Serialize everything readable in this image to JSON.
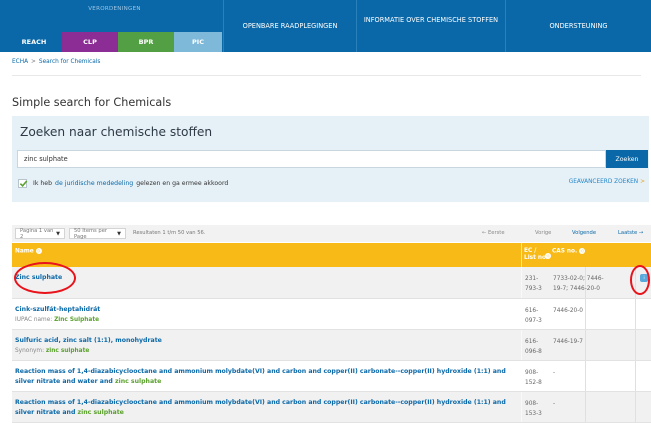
{
  "nav": {
    "regulations_label": "VERORDENINGEN",
    "tabs": [
      {
        "label": "REACH",
        "color": "#0a68a8"
      },
      {
        "label": "CLP",
        "color": "#8c2c95"
      },
      {
        "label": "BPR",
        "color": "#52a043"
      },
      {
        "label": "PIC",
        "color": "#7fb9d9"
      }
    ],
    "items": [
      {
        "label": "OPENBARE RAADPLEGINGEN"
      },
      {
        "label": "INFORMATIE OVER CHEMISCHE STOFFEN"
      },
      {
        "label": "ONDERSTEUNING"
      }
    ]
  },
  "breadcrumb": {
    "home": "ECHA",
    "separator": ">",
    "current": "Search for Chemicals"
  },
  "page_title": "Simple search for Chemicals",
  "search": {
    "heading": "Zoeken naar chemische stoffen",
    "value": "zinc sulphate",
    "button_label": "Zoeken",
    "consent_prefix": "Ik heb",
    "consent_link": "de juridische mededeling",
    "consent_suffix": "gelezen en ga ermee akkoord",
    "consent_checked": true,
    "advanced_label": "GEAVANCEERD ZOEKEN",
    "advanced_chevron": ">"
  },
  "pager": {
    "page_select": "Pagina 1 van 2",
    "size_select": "50 Items per Page",
    "results": "Resultaten 1 t/m 50 van 56.",
    "first": "← Eerste",
    "prev": "Vorige",
    "next": "Volgende",
    "last": "Laatste →"
  },
  "table": {
    "headers": {
      "name": "Name",
      "ec_line1": "EC /",
      "ec_line2": "List no.",
      "cas": "CAS no."
    },
    "rows": [
      {
        "name": "Zinc sulphate",
        "sub_label": "",
        "sub_value": "",
        "ec_line1": "231-",
        "ec_line2": "793-3",
        "cas_line1": "7733-02-0; 7446-",
        "cas_line2": "19-7; 7446-20-0",
        "badge": "i"
      },
      {
        "name": "Cink-szulfát-heptahidrát",
        "sub_label": "IUPAC name:",
        "sub_value": "Zinc Sulphate",
        "ec_line1": "616-",
        "ec_line2": "097-3",
        "cas_line1": "7446-20-0",
        "cas_line2": ""
      },
      {
        "name": "Sulfuric acid, zinc salt (1:1), monohydrate",
        "sub_label": "Synonym:",
        "sub_value": "zinc sulphate",
        "ec_line1": "616-",
        "ec_line2": "096-8",
        "cas_line1": "7446-19-7",
        "cas_line2": ""
      },
      {
        "name_part1": "Reaction mass of 1,4-diazabicyclooctane and ammonium molybdate(VI) and carbon and copper(II) carbonate--copper(II) hydroxide (1:1) and",
        "name_part2": "silver nitrate and water and",
        "name_hl": "zinc sulphate",
        "ec_line1": "908-",
        "ec_line2": "152-8",
        "cas_line1": "-",
        "cas_line2": ""
      },
      {
        "name_part1": "Reaction mass of 1,4-diazabicyclooctane and ammonium molybdate(VI) and carbon and copper(II) carbonate--copper(II) hydroxide (1:1) and",
        "name_part2": "silver nitrate and",
        "name_hl": "zinc sulphate",
        "ec_line1": "908-",
        "ec_line2": "153-3",
        "cas_line1": "-",
        "cas_line2": ""
      }
    ]
  },
  "colors": {
    "primary": "#0a68a8",
    "header_yellow": "#f7ba17",
    "highlight_green": "#5aa02c",
    "annotation_red": "#e8131b"
  }
}
